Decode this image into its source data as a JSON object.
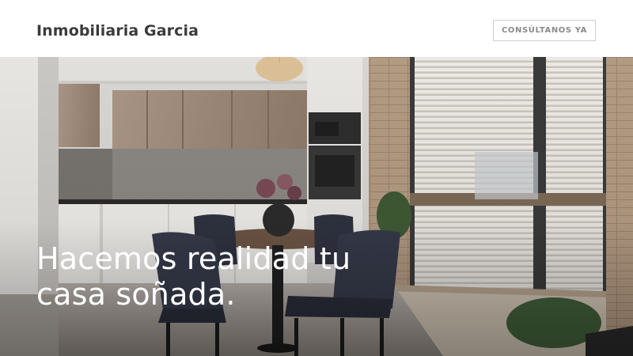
{
  "header": {
    "brand": "Inmobiliaria Garcia",
    "cta_label": "CONSÚLTANOS YA"
  },
  "hero": {
    "headline_line1": "Hacemos realidad tu",
    "headline_line2": "casa soñada."
  }
}
